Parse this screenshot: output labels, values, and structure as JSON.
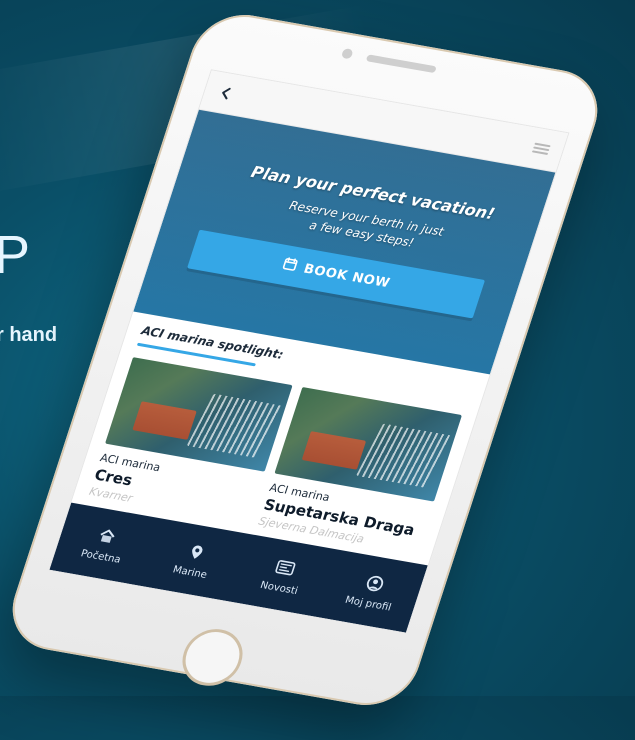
{
  "background": {
    "partial_heading": "P",
    "partial_tagline": "r hand"
  },
  "app": {
    "header": {
      "back_icon": "chevron-left",
      "menu_icon": "hamburger"
    },
    "hero": {
      "title": "Plan your perfect vacation!",
      "subtitle_line1": "Reserve your berth in just",
      "subtitle_line2": "a few easy steps!",
      "cta_icon": "calendar",
      "cta_label": "BOOK NOW"
    },
    "spotlight": {
      "title": "ACI marina spotlight:",
      "cards": [
        {
          "kicker": "ACI marina",
          "name": "Cres",
          "region": "Kvarner"
        },
        {
          "kicker": "ACI marina",
          "name": "Supetarska Draga",
          "region": "Sjeverna Dalmacija"
        }
      ]
    },
    "bottom_nav": [
      {
        "label": "Početna",
        "icon": "home"
      },
      {
        "label": "Marine",
        "icon": "location-pin"
      },
      {
        "label": "Novosti",
        "icon": "newspaper"
      },
      {
        "label": "Moj profil",
        "icon": "user"
      }
    ]
  },
  "colors": {
    "background": "#0a4f67",
    "accent": "#35a7e6",
    "nav_bg": "#0f2743"
  }
}
